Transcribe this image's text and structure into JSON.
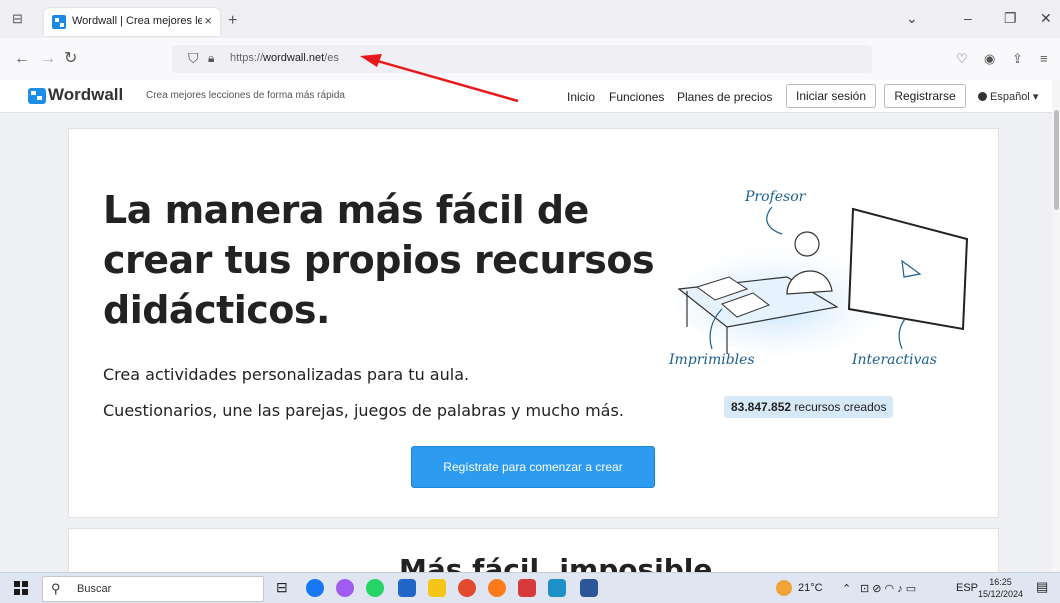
{
  "browser": {
    "tab_title": "Wordwall | Crea mejores lecciones",
    "tab_close": "×",
    "new_tab": "+",
    "url_scheme": "https://",
    "url_host": "wordwall.net",
    "url_path": "/es",
    "controls": {
      "dropdown": "⌄",
      "minimize": "–",
      "restore": "❐",
      "close": "✕"
    }
  },
  "site": {
    "logo": "Wordwall",
    "tagline": "Crea mejores lecciones de forma más rápida",
    "nav": {
      "home": "Inicio",
      "features": "Funciones",
      "pricing": "Planes de precios"
    },
    "login": "Iniciar sesión",
    "register": "Registrarse",
    "language": "Español"
  },
  "hero": {
    "title": "La manera más fácil de crear tus propios recursos didácticos.",
    "line1": "Crea actividades personalizadas para tu aula.",
    "line2": "Cuestionarios, une las parejas, juegos de palabras y mucho más.",
    "cta": "Regístrate para comenzar a crear",
    "illustration": {
      "teacher": "Profesor",
      "printables": "Imprimibles",
      "interactives": "Interactivas"
    },
    "resource_count": "83.847.852",
    "resource_suffix": "recursos creados"
  },
  "section2": {
    "title": "Más fácil, imposible"
  },
  "taskbar": {
    "search_placeholder": "Buscar",
    "weather": "21°C",
    "language": "ESP",
    "time": "16:25",
    "date": "15/12/2024"
  },
  "colors": {
    "accent": "#2d9bf0",
    "annotation": "#e8191c"
  }
}
